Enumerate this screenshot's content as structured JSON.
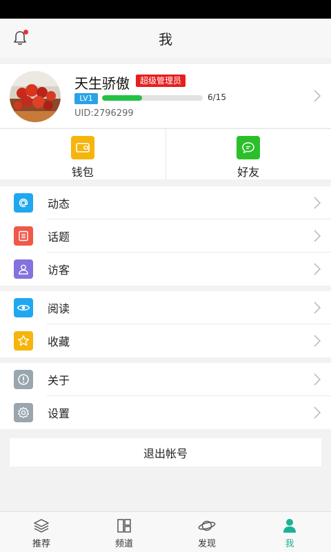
{
  "header": {
    "title": "我",
    "notification_icon": "bell-icon"
  },
  "profile": {
    "name": "天生骄傲",
    "role_badge": "超级管理员",
    "level": "LV1",
    "progress_text": "6/15",
    "progress_fraction": 0.4,
    "uid": "UID:2796299"
  },
  "quick_actions": [
    {
      "label": "钱包",
      "icon": "wallet-icon",
      "color": "#f5b50c"
    },
    {
      "label": "好友",
      "icon": "chat-icon",
      "color": "#2bc02b"
    }
  ],
  "menu_groups": [
    [
      {
        "label": "动态",
        "icon": "at-icon",
        "color": "#1fa8f0"
      },
      {
        "label": "话题",
        "icon": "list-icon",
        "color": "#f0584a"
      },
      {
        "label": "访客",
        "icon": "person-icon",
        "color": "#8472e0"
      }
    ],
    [
      {
        "label": "阅读",
        "icon": "eye-icon",
        "color": "#1fa8f0"
      },
      {
        "label": "收藏",
        "icon": "star-icon",
        "color": "#f5b50c"
      }
    ],
    [
      {
        "label": "关于",
        "icon": "info-icon",
        "color": "#9aa6ae"
      },
      {
        "label": "设置",
        "icon": "gear-icon",
        "color": "#9aa6ae"
      }
    ]
  ],
  "logout_label": "退出帐号",
  "tabs": [
    {
      "label": "推荐",
      "icon": "layers-icon",
      "active": false
    },
    {
      "label": "频道",
      "icon": "grid-icon",
      "active": false
    },
    {
      "label": "发现",
      "icon": "planet-icon",
      "active": false
    },
    {
      "label": "我",
      "icon": "user-icon",
      "active": true
    }
  ],
  "colors": {
    "accent": "#1ab394",
    "badge_red": "#e61e1e",
    "level_blue": "#2aa3e6",
    "progress_green": "#25c146"
  }
}
